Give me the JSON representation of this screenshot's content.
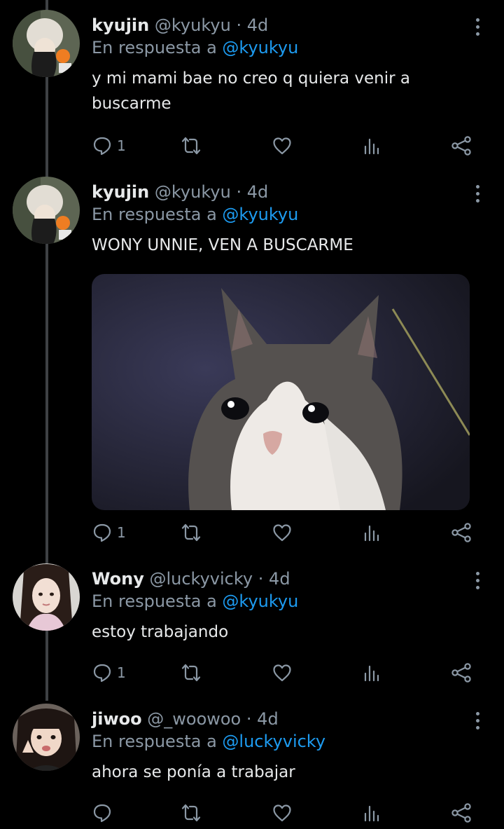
{
  "tweets": [
    {
      "name": "kyujin",
      "handle": "@kyukyu",
      "time": "4d",
      "reply_prefix": "En respuesta a",
      "reply_to": "@kyukyu",
      "text": "y mi mami bae no creo q quiera venir a buscarme",
      "reply_count": "1"
    },
    {
      "name": "kyujin",
      "handle": "@kyukyu",
      "time": "4d",
      "reply_prefix": "En respuesta a",
      "reply_to": "@kyukyu",
      "text": "WONY UNNIE, VEN A BUSCARME",
      "reply_count": "1",
      "media": "crying cat photo"
    },
    {
      "name": "Wony",
      "handle": "@luckyvicky",
      "time": "4d",
      "reply_prefix": "En respuesta a",
      "reply_to": "@kyukyu",
      "text": "estoy trabajando",
      "reply_count": "1"
    },
    {
      "name": "jiwoo",
      "handle": "@_woowoo",
      "time": "4d",
      "reply_prefix": "En respuesta a",
      "reply_to": "@luckyvicky",
      "text": "ahora se ponía a trabajar",
      "reply_count": ""
    }
  ],
  "colors": {
    "background": "#000000",
    "text": "#e7e9ea",
    "muted": "#8b98a5",
    "accent": "#1d9bf0",
    "thread_line": "#3e4144"
  },
  "icons": [
    "reply-icon",
    "retweet-icon",
    "like-icon",
    "views-icon",
    "share-icon",
    "more-icon"
  ]
}
